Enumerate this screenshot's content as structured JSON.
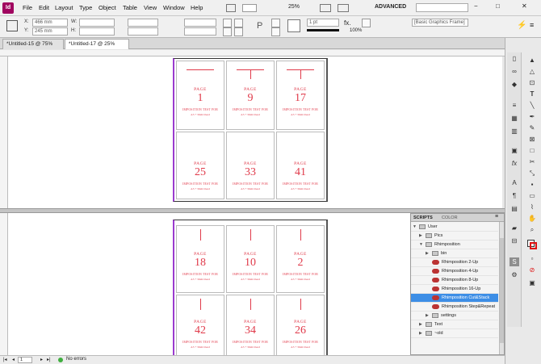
{
  "app": {
    "logo": "Id",
    "brand_color": "#a0045f"
  },
  "menu": [
    "File",
    "Edit",
    "Layout",
    "Type",
    "Object",
    "Table",
    "View",
    "Window",
    "Help"
  ],
  "appbar": {
    "zoom": "25%",
    "workspace": "ADVANCED",
    "search_placeholder": ""
  },
  "control": {
    "x_label": "X:",
    "x_value": "466 mm",
    "y_label": "Y:",
    "y_value": "245 mm",
    "w_label": "W:",
    "w_value": "",
    "h_label": "H:",
    "h_value": "",
    "stroke_weight": "1 pt",
    "opacity": "100%",
    "fx": "fx.",
    "object_style": "[Basic Graphics Frame]"
  },
  "tabs": [
    {
      "label": "*Untitled-15 @ 75%",
      "active": false
    },
    {
      "label": "*Untitled-17 @ 25%",
      "active": true
    }
  ],
  "pages": {
    "word": "PAGE",
    "line1": "IMPOSITION TEST FOR",
    "line2": "A5 + 3mm bleed",
    "top_spread": [
      "1",
      "9",
      "17",
      "25",
      "33",
      "41"
    ],
    "bottom_spread": [
      "18",
      "10",
      "2",
      "42",
      "34",
      "26"
    ]
  },
  "status": {
    "page": "1",
    "errors": "No errors"
  },
  "scripts_panel": {
    "tabs": [
      "SCRIPTS",
      "COLOR"
    ],
    "items": [
      {
        "label": "User",
        "level": 0,
        "type": "folder",
        "open": true
      },
      {
        "label": "Pics",
        "level": 1,
        "type": "folder",
        "open": false
      },
      {
        "label": "Rhimposition",
        "level": 1,
        "type": "folder",
        "open": true
      },
      {
        "label": "bin",
        "level": 2,
        "type": "folder",
        "open": false
      },
      {
        "label": "Rhimposition 2-Up",
        "level": 2,
        "type": "script"
      },
      {
        "label": "Rhimposition 4-Up",
        "level": 2,
        "type": "script"
      },
      {
        "label": "Rhimposition 8-Up",
        "level": 2,
        "type": "script"
      },
      {
        "label": "Rhimposition 16-Up",
        "level": 2,
        "type": "script"
      },
      {
        "label": "Rhimposition Cut&Stack",
        "level": 2,
        "type": "script",
        "selected": true
      },
      {
        "label": "Rhimposition Step&Repeat",
        "level": 2,
        "type": "script"
      },
      {
        "label": "settings",
        "level": 2,
        "type": "folder",
        "open": false
      },
      {
        "label": "Text",
        "level": 1,
        "type": "folder",
        "open": false
      },
      {
        "label": "~old",
        "level": 1,
        "type": "folder",
        "open": false
      }
    ]
  },
  "toolbar_icons": [
    "selection-tool",
    "direct-selection-tool",
    "page-tool",
    "gap-tool",
    "type-tool",
    "line-tool",
    "pen-tool",
    "pencil-tool",
    "frame-tool",
    "rectangle-tool",
    "scissors-tool",
    "free-transform-tool",
    "gradient-tool",
    "note-tool",
    "eyedropper-tool",
    "hand-tool",
    "zoom-tool",
    "fill-stroke-swatch",
    "view-mode-button"
  ]
}
